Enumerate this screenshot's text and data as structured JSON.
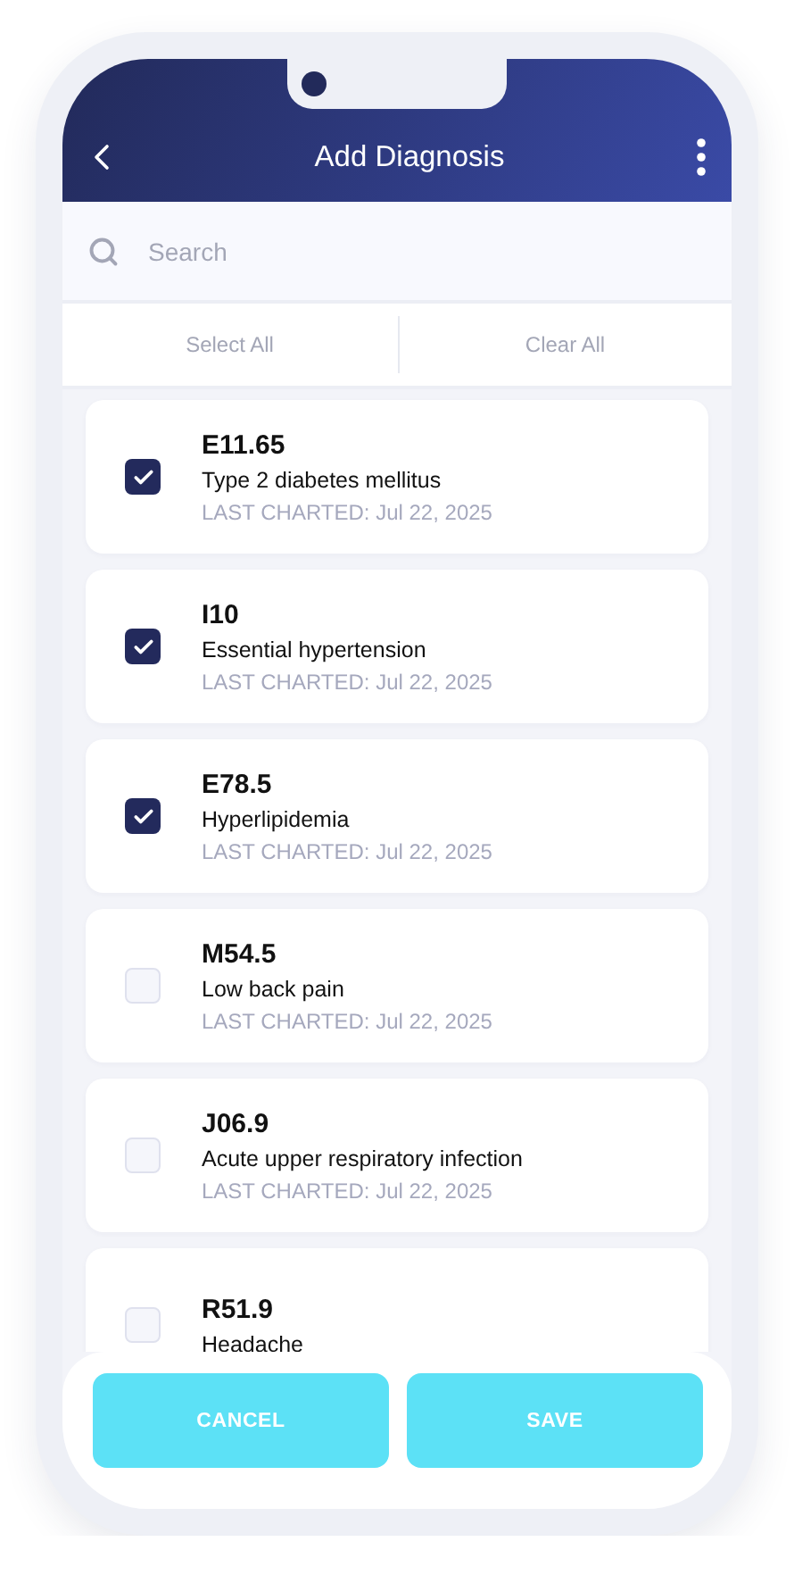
{
  "header": {
    "title": "Add Diagnosis"
  },
  "search": {
    "placeholder": "Search"
  },
  "bulk_actions": [
    "Select All",
    "Clear All"
  ],
  "diagnoses": [
    {
      "code": "E11.65",
      "name": "Type 2 diabetes mellitus",
      "last_charted": "LAST CHARTED: Jul 22, 2025",
      "checked": true
    },
    {
      "code": "I10",
      "name": "Essential hypertension",
      "last_charted": "LAST CHARTED: Jul 22, 2025",
      "checked": true
    },
    {
      "code": "E78.5",
      "name": "Hyperlipidemia",
      "last_charted": "LAST CHARTED: Jul 22, 2025",
      "checked": true
    },
    {
      "code": "M54.5",
      "name": "Low back pain",
      "last_charted": "LAST CHARTED: Jul 22, 2025",
      "checked": false
    },
    {
      "code": "J06.9",
      "name": "Acute upper respiratory infection",
      "last_charted": "LAST CHARTED: Jul 22, 2025",
      "checked": false
    },
    {
      "code": "R51.9",
      "name": "Headache",
      "checked": false
    }
  ],
  "footer": {
    "buttons": [
      "CANCEL",
      "SAVE"
    ]
  }
}
